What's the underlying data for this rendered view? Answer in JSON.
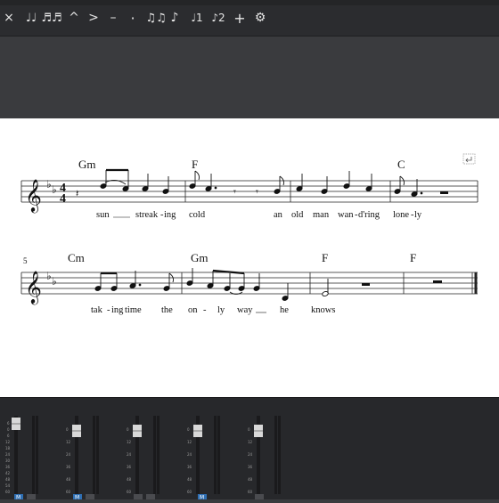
{
  "toolbar": {
    "items": [
      {
        "name": "close-button",
        "glyph": "×"
      },
      {
        "name": "tie-notes-button",
        "glyph": "♩♩"
      },
      {
        "name": "beam-notes-button",
        "glyph": "♬♬"
      },
      {
        "name": "marcato-button",
        "glyph": "^"
      },
      {
        "name": "accent-button",
        "glyph": ">"
      },
      {
        "name": "tenuto-button",
        "glyph": "–"
      },
      {
        "name": "staccato-button",
        "glyph": "·"
      },
      {
        "name": "tuplet-button",
        "glyph": "♫♫"
      },
      {
        "name": "grace-note-button",
        "glyph": "♪"
      },
      {
        "name": "voice-1-button",
        "glyph": "♩1"
      },
      {
        "name": "voice-2-button",
        "glyph": "♪2"
      },
      {
        "name": "add-button",
        "glyph": "+"
      },
      {
        "name": "settings-button",
        "glyph": "⚙"
      }
    ]
  },
  "score": {
    "system1": {
      "chords": [
        "Gm",
        "F",
        "C"
      ],
      "lyrics": [
        "sun",
        "streak",
        "ing",
        "cold",
        "an",
        "old",
        "man",
        "wan",
        "d'ring",
        "lone",
        "ly"
      ]
    },
    "system2": {
      "measure_number": "5",
      "chords": [
        "Cm",
        "Gm",
        "F",
        "F"
      ],
      "lyrics": [
        "tak",
        "ing",
        "time",
        "the",
        "on",
        "ly",
        "way",
        "he",
        "knows"
      ]
    },
    "time_signature": {
      "top": "4",
      "bottom": "4"
    },
    "line_break_icon": "line-break-icon"
  },
  "mixer": {
    "scale_labels": [
      "6",
      "0",
      "6",
      "12",
      "18",
      "24",
      "30",
      "36",
      "42",
      "48",
      "54",
      "60"
    ],
    "channel_button_label": "M"
  }
}
